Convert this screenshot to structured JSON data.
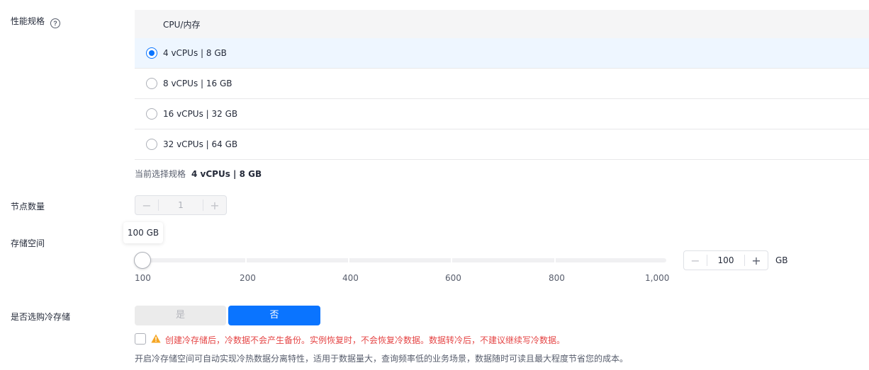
{
  "performance": {
    "label": "性能规格",
    "help_icon": "question-circle-icon",
    "header": "CPU/内存",
    "options": [
      {
        "label": "4 vCPUs | 8 GB",
        "selected": true
      },
      {
        "label": "8 vCPUs | 16 GB",
        "selected": false
      },
      {
        "label": "16 vCPUs | 32 GB",
        "selected": false
      },
      {
        "label": "32 vCPUs | 64 GB",
        "selected": false
      }
    ],
    "current_label": "当前选择规格",
    "current_value": "4 vCPUs | 8 GB"
  },
  "nodes": {
    "label": "节点数量",
    "value": "1",
    "minus": "−",
    "plus": "+"
  },
  "storage": {
    "label": "存储空间",
    "tooltip": "100 GB",
    "slider_marks": [
      "100",
      "200",
      "400",
      "600",
      "800",
      "1,000"
    ],
    "value": "100",
    "minus": "−",
    "plus": "+",
    "unit": "GB"
  },
  "cold_storage": {
    "label": "是否选购冷存储",
    "yes": "是",
    "no": "否",
    "warning": "创建冷存储后，冷数据不会产生备份。实例恢复时，不会恢复冷数据。数据转冷后，不建议继续写冷数据。",
    "description": "开启冷存储空间可自动实现冷热数据分离特性，适用于数据量大，查询频率低的业务场景，数据随时可读且最大程度节省您的成本。"
  },
  "colors": {
    "accent": "#0a74ff",
    "warning": "#e54545",
    "warning_icon": "#f5a623"
  }
}
